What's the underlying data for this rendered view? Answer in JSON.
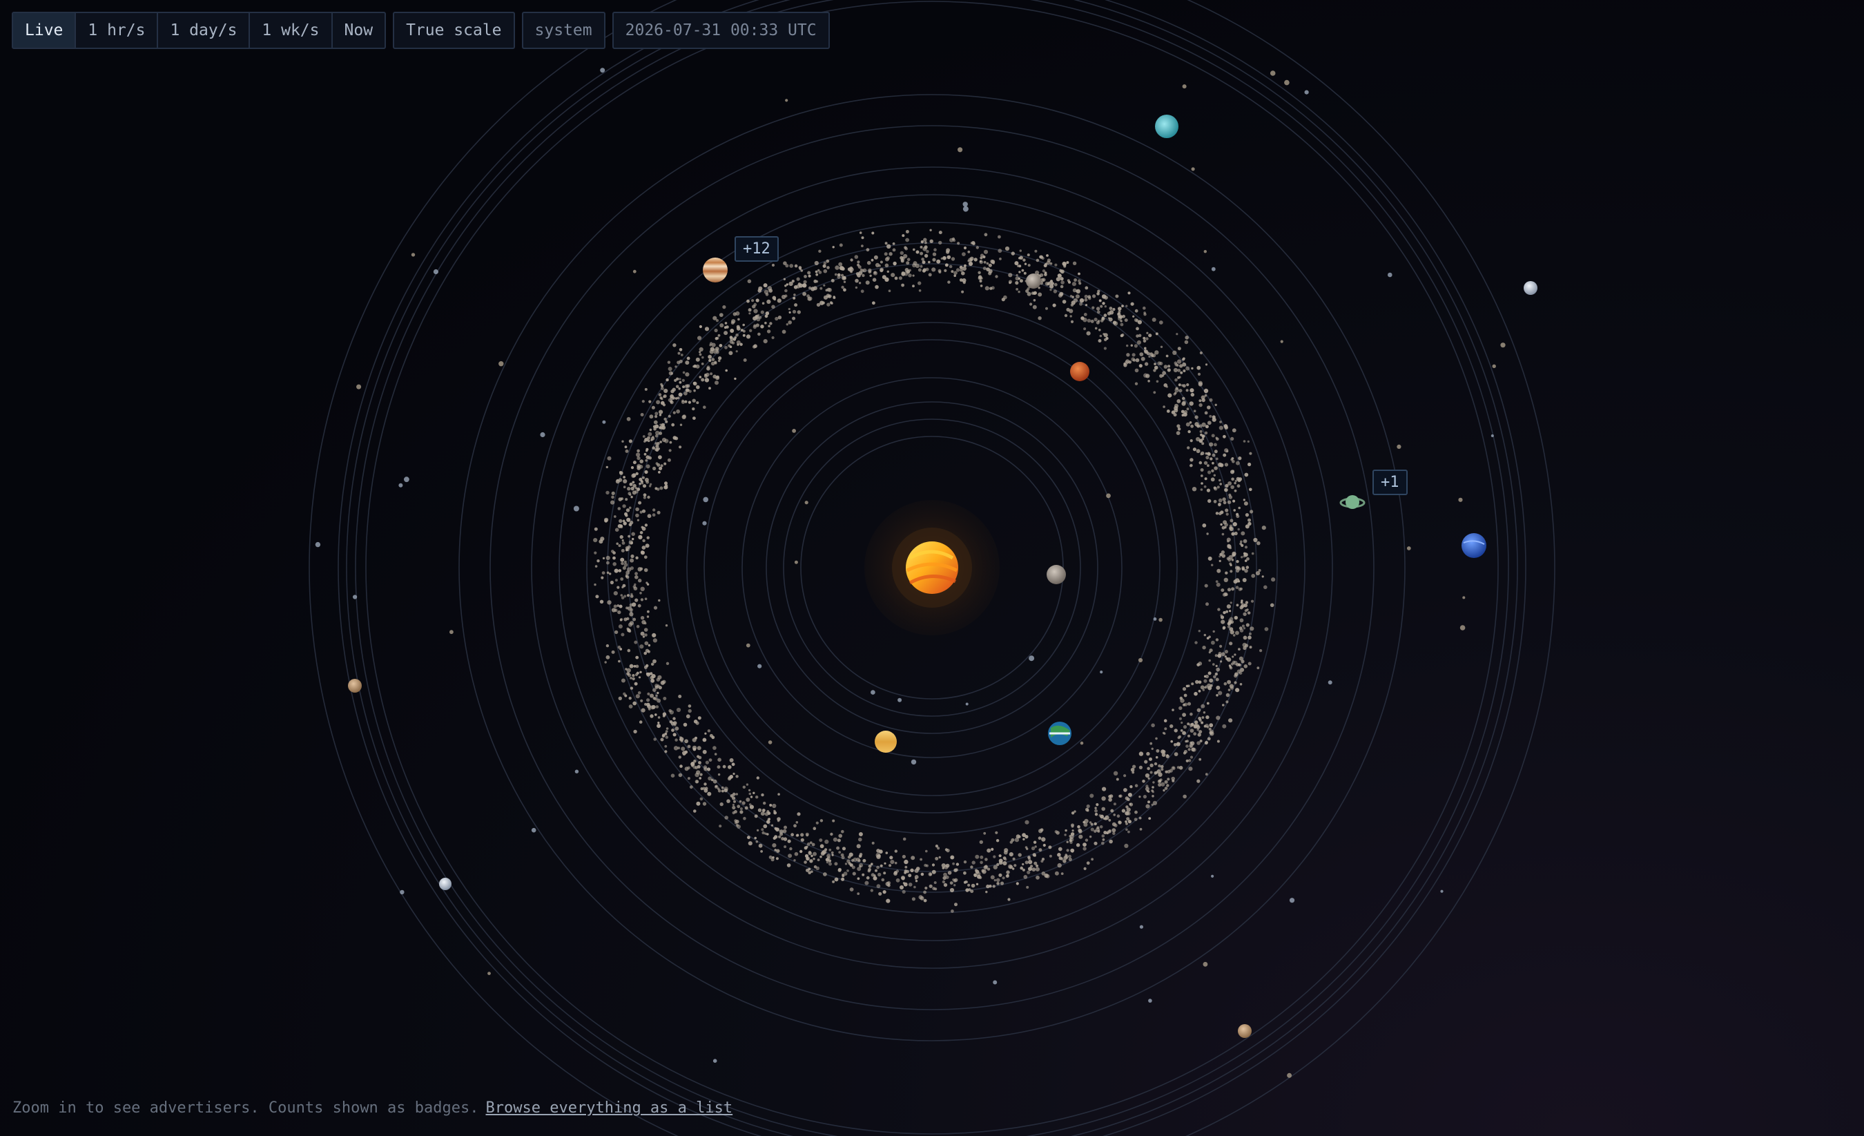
{
  "toolbar": {
    "speed_buttons": [
      "Live",
      "1 hr/s",
      "1 day/s",
      "1 wk/s",
      "Now"
    ],
    "active_speed": "Live",
    "scale_button": "True scale",
    "view_label": "system",
    "datetime": "2026-07-31 00:33 UTC"
  },
  "badges": {
    "jupiter_count": "+12",
    "saturn_count": "+1"
  },
  "footer": {
    "hint": "Zoom in to see advertisers. Counts shown as badges.",
    "link": "Browse everything as a list"
  },
  "colors": {
    "background": "#05060c",
    "orbit": "#2a3142",
    "sun_core": "#ffc42e",
    "sun_shadow": "#e2551a",
    "asteroid": "#b1a79a",
    "badge_border": "#2f4560"
  },
  "icons": {
    "sun": "sun-icon",
    "mercury": "mercury-icon",
    "venus": "venus-icon",
    "earth": "earth-icon",
    "mars": "mars-icon",
    "jupiter": "jupiter-icon",
    "saturn": "saturn-icon",
    "uranus": "uranus-icon",
    "neptune": "neptune-icon"
  }
}
